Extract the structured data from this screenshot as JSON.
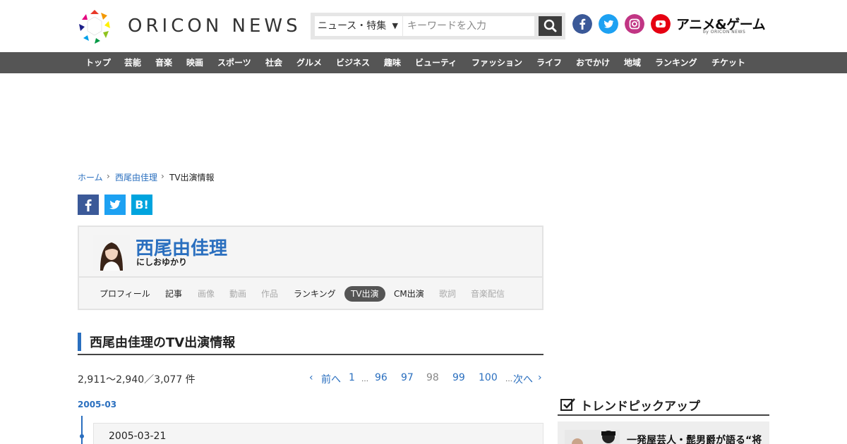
{
  "header": {
    "logo_text": "ORICON NEWS",
    "search_category": "ニュース・特集",
    "search_placeholder": "キーワードを入力",
    "anime_logo": "アニメ&ゲーム",
    "anime_logo_sub": "by ORICON NEWS"
  },
  "nav": [
    "トップ",
    "芸能",
    "音楽",
    "映画",
    "スポーツ",
    "社会",
    "グルメ",
    "ビジネス",
    "趣味",
    "ビューティ",
    "ファッション",
    "ライフ",
    "おでかけ",
    "地域",
    "ランキング",
    "チケット"
  ],
  "breadcrumb": [
    "ホーム",
    "西尾由佳理",
    "TV出演情報"
  ],
  "share": {
    "hatena": "B!"
  },
  "profile": {
    "name": "西尾由佳理",
    "kana": "にしおゆかり",
    "tabs": [
      "プロフィール",
      "記事",
      "画像",
      "動画",
      "作品",
      "ランキング",
      "TV出演",
      "CM出演",
      "歌詞",
      "音楽配信"
    ]
  },
  "section_title": "西尾由佳理のTV出演情報",
  "result_count": "2,911～2,940／3,077 件",
  "pagination": {
    "prev": "前へ",
    "pages": [
      "1",
      "96",
      "97",
      "98",
      "99",
      "100"
    ],
    "next": "次へ",
    "dots": "…"
  },
  "timeline": {
    "month": "2005-03",
    "entry_date": "2005-03-21"
  },
  "sidebar": {
    "trend_title": "トレンドピックアップ",
    "trend_item": "一発屋芸人・髭男爵が語る“将"
  },
  "colors": {
    "accent": "#2a6fbf",
    "nav_bg": "#555555",
    "active_tab": "#555555"
  }
}
